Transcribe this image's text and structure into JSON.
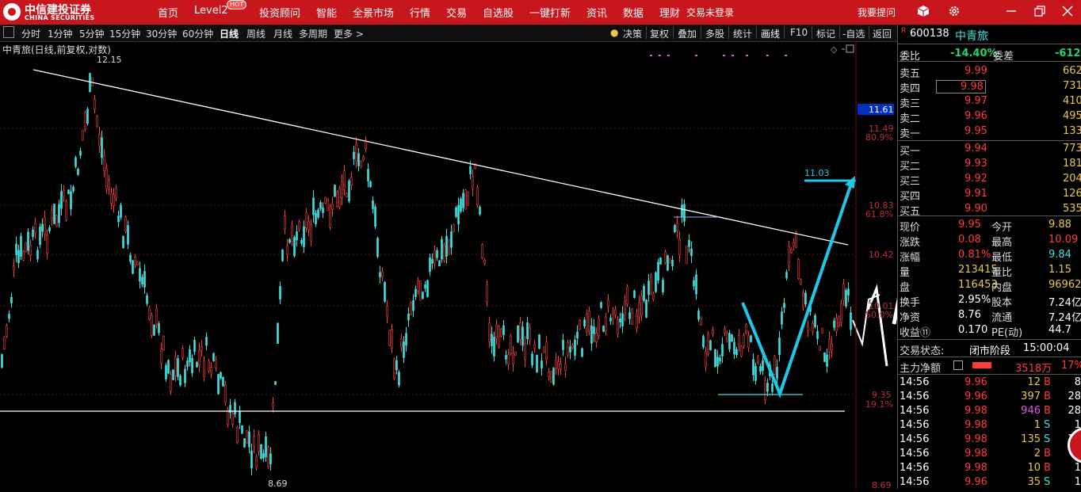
{
  "brand": {
    "name_cn": "中信建投证券",
    "name_en": "CHINA SECURITIES"
  },
  "nav": {
    "items": [
      "首页",
      "Level2",
      "投资顾问",
      "智能",
      "全景市场",
      "行情",
      "交易",
      "自选股",
      "一键打新",
      "资讯",
      "数据",
      "理财"
    ],
    "hot_badge": "HOT",
    "login_status": "交易未登录",
    "ask_question": "我要提问"
  },
  "toolbar": {
    "periods": [
      "分时",
      "1分钟",
      "5分钟",
      "15分钟",
      "30分钟",
      "60分钟",
      "日线",
      "周线",
      "月线",
      "多周期",
      "更多 >"
    ],
    "tools": [
      "决策",
      "复权",
      "叠加",
      "多股",
      "统计",
      "画线",
      "F10",
      "标记",
      "-自选",
      "返回"
    ]
  },
  "chart": {
    "title": "中青旅(日线,前复权,对数)",
    "high_label": "12.15",
    "low_label": "8.69",
    "target_label": "11.03",
    "current_axis_label": "11.61",
    "price_axis": [
      "11.49",
      "10.83",
      "10.42",
      "10.01",
      "9.35",
      "8.69"
    ],
    "pct_axis": [
      "80.9%",
      "61.8%",
      "50.0%",
      "19.1%"
    ]
  },
  "quote": {
    "code": "600138",
    "name": "中青旅",
    "weibi_label": "委比",
    "weibi": "-14.40%",
    "weicha_label": "委差",
    "weicha": "-612",
    "asks": [
      {
        "label": "卖五",
        "price": "9.99",
        "vol": "662"
      },
      {
        "label": "卖四",
        "price": "9.98",
        "vol": "731"
      },
      {
        "label": "卖三",
        "price": "9.97",
        "vol": "410"
      },
      {
        "label": "卖二",
        "price": "9.96",
        "vol": "495"
      },
      {
        "label": "卖一",
        "price": "9.95",
        "vol": "133"
      }
    ],
    "bids": [
      {
        "label": "买一",
        "price": "9.94",
        "vol": "773"
      },
      {
        "label": "买二",
        "price": "9.93",
        "vol": "181"
      },
      {
        "label": "买三",
        "price": "9.92",
        "vol": "204"
      },
      {
        "label": "买四",
        "price": "9.91",
        "vol": "126"
      },
      {
        "label": "买五",
        "price": "9.90",
        "vol": "535"
      }
    ],
    "stats": [
      [
        "现价",
        "9.95",
        "今开",
        "9.88"
      ],
      [
        "涨跌",
        "0.08",
        "最高",
        "10.09"
      ],
      [
        "涨幅",
        "0.81%",
        "最低",
        "9.84"
      ],
      [
        "量",
        "213415",
        "量比",
        "1.15"
      ],
      [
        "盘",
        "116453",
        "内盘",
        "96962"
      ],
      [
        "换手",
        "2.95%",
        "股本",
        "7.24亿"
      ],
      [
        "净资",
        "8.76",
        "流通",
        "7.24亿"
      ],
      [
        "收益⑪",
        "0.170",
        "PE(动)",
        "44.7"
      ]
    ],
    "trade_status_label": "交易状态:",
    "trade_status": "闭市阶段",
    "trade_time": "15:00:04",
    "main_flow_label": "主力净额",
    "main_flow": "3518万",
    "main_flow_pct": "17%",
    "ticks": [
      [
        "14:56",
        "9.96",
        "12",
        "B",
        "8"
      ],
      [
        "14:56",
        "9.96",
        "397",
        "B",
        "28"
      ],
      [
        "14:56",
        "9.98",
        "946",
        "B",
        "28"
      ],
      [
        "14:56",
        "9.98",
        "1",
        "S",
        "1"
      ],
      [
        "14:56",
        "9.98",
        "135",
        "S",
        "25"
      ],
      [
        "14:56",
        "9.98",
        "2",
        "B",
        "1"
      ],
      [
        "14:56",
        "9.98",
        "10",
        "B",
        "1"
      ],
      [
        "14:56",
        "9.96",
        "35",
        "S",
        "1"
      ]
    ]
  },
  "colors": {
    "up": "#ff3a3a",
    "down": "#3fe0e0",
    "topbar": "#c8161d",
    "drawline": "#1ec8e8"
  }
}
